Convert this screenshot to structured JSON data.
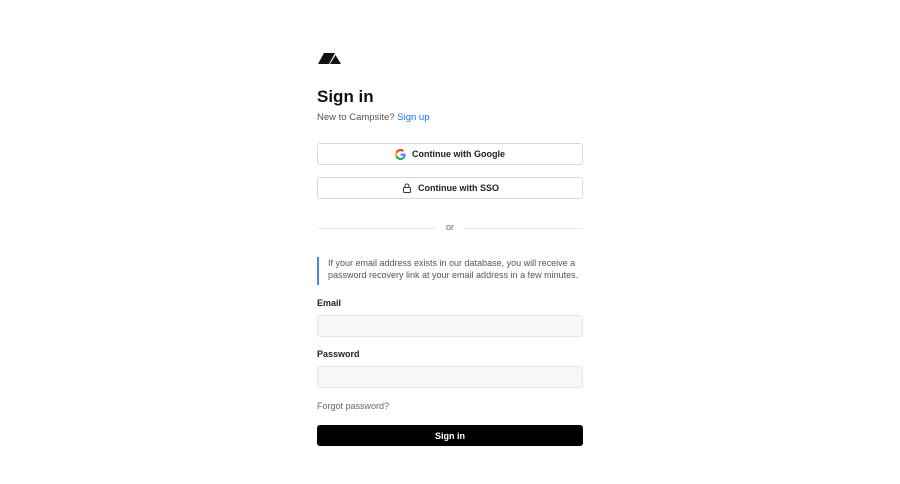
{
  "app": {
    "logo_icon": "campsite-logo-icon"
  },
  "header": {
    "title": "Sign in",
    "subtitle_prefix": "New to Campsite?",
    "signup_link": "Sign up"
  },
  "oauth": {
    "google_label": "Continue with Google",
    "google_icon": "google-icon",
    "sso_label": "Continue with SSO",
    "sso_icon": "lock-icon"
  },
  "divider": {
    "text": "or"
  },
  "notice": {
    "text": "If your email address exists in our database, you will receive a password recovery link at your email address in a few minutes."
  },
  "form": {
    "email_label": "Email",
    "email_value": "",
    "email_placeholder": "",
    "password_label": "Password",
    "password_value": "",
    "password_placeholder": "",
    "forgot_label": "Forgot password?",
    "submit_label": "Sign in"
  },
  "colors": {
    "accent": "#1a73e8",
    "notice_border": "#4a86e8",
    "primary_button": "#000000"
  }
}
